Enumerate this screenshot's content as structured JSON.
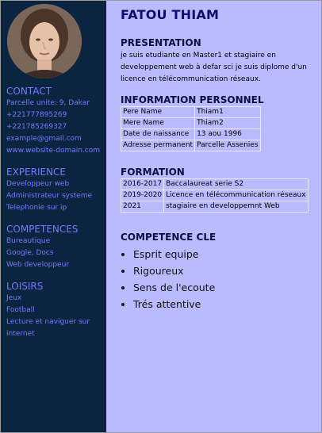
{
  "sidebar": {
    "contact_title": "CONTACT",
    "contact_items": [
      "Parcelle unite: 9, Dakar",
      "+221777895269",
      "+221785269327",
      "example@gmail.com",
      "www.website-domain.com"
    ],
    "experience_title": "EXPERIENCE",
    "experience_items": [
      "Developpeur web",
      "Administrateur systeme",
      "Telephonie sur ip"
    ],
    "competences_title": "COMPETENCES",
    "competences_items": [
      "Bureautique",
      "Google, Docs",
      "Web developpeur"
    ],
    "loisirs_title": "LOISIRS",
    "loisirs_items": [
      "Jeux",
      "Football",
      "Lecture et naviguer sur internet"
    ]
  },
  "main": {
    "name": "FATOU THIAM",
    "presentation_title": "PRESENTATION",
    "presentation_text": "je suis etudiante en Master1 et stagiaire en developpement web à defar sci je suis diplome d'un licence en télécommunication réseaux.",
    "info_title": "INFORMATION PERSONNEL",
    "info_rows": [
      [
        "Pere Name",
        "Thiam1"
      ],
      [
        "Mere Name",
        "Thiam2"
      ],
      [
        "Date de naissance",
        "13 aou 1996"
      ],
      [
        "Adresse permanent",
        "Parcelle Assenies"
      ]
    ],
    "formation_title": "FORMATION",
    "formation_rows": [
      [
        "2016-2017",
        "Baccalaureat serie S2"
      ],
      [
        "2019-2020",
        "Licence en télécommunication réseaux"
      ],
      [
        "2021",
        "stagiaire en developpemnt Web"
      ]
    ],
    "competence_cle_title": "COMPETENCE CLE",
    "competence_cle_items": [
      "Esprit equipe",
      "Rigoureux",
      "Sens de l'ecoute",
      "Trés attentive"
    ]
  }
}
